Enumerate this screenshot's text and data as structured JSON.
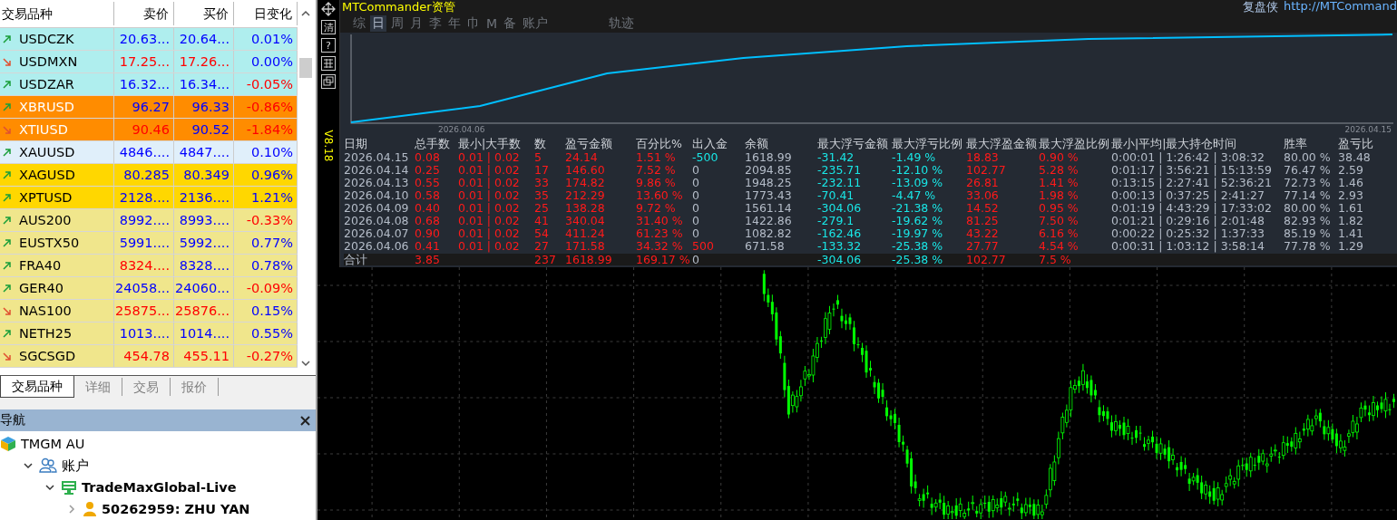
{
  "market_watch": {
    "columns": [
      "交易品种",
      "卖价",
      "买价",
      "日变化"
    ],
    "rows": [
      {
        "symbol": "USDCZK",
        "rising": true,
        "color": "#afeeee",
        "bid": "20.63...",
        "bid_down": false,
        "ask": "20.64...",
        "ask_down": false,
        "change": "0.01%",
        "change_down": false
      },
      {
        "symbol": "USDMXN",
        "rising": false,
        "color": "#afeeee",
        "bid": "17.25...",
        "bid_down": true,
        "ask": "17.26...",
        "ask_down": true,
        "change": "0.00%",
        "change_down": false
      },
      {
        "symbol": "USDZAR",
        "rising": true,
        "color": "#afeeee",
        "bid": "16.32...",
        "bid_down": false,
        "ask": "16.34...",
        "ask_down": false,
        "change": "-0.05%",
        "change_down": true
      },
      {
        "symbol": "XBRUSD",
        "rising": true,
        "color": "#ff8c00",
        "bid": "96.27",
        "bid_down": false,
        "ask": "96.33",
        "ask_down": false,
        "change": "-0.86%",
        "change_down": true
      },
      {
        "symbol": "XTIUSD",
        "rising": false,
        "color": "#ff8c00",
        "bid": "90.46",
        "bid_down": true,
        "ask": "90.52",
        "ask_down": false,
        "change": "-1.84%",
        "change_down": true
      },
      {
        "symbol": "XAUUSD",
        "rising": true,
        "color": "#e0effa",
        "bid": "4846....",
        "bid_down": false,
        "ask": "4847....",
        "ask_down": false,
        "change": "0.10%",
        "change_down": false
      },
      {
        "symbol": "XAGUSD",
        "rising": true,
        "color": "#ffd700",
        "bid": "80.285",
        "bid_down": false,
        "ask": "80.349",
        "ask_down": false,
        "change": "0.96%",
        "change_down": false
      },
      {
        "symbol": "XPTUSD",
        "rising": true,
        "color": "#ffd700",
        "bid": "2128....",
        "bid_down": false,
        "ask": "2136....",
        "ask_down": false,
        "change": "1.21%",
        "change_down": false
      },
      {
        "symbol": "AUS200",
        "rising": true,
        "color": "#f0e68c",
        "bid": "8992....",
        "bid_down": false,
        "ask": "8993....",
        "ask_down": false,
        "change": "-0.33%",
        "change_down": true
      },
      {
        "symbol": "EUSTX50",
        "rising": true,
        "color": "#f0e68c",
        "bid": "5991....",
        "bid_down": false,
        "ask": "5992....",
        "ask_down": false,
        "change": "0.77%",
        "change_down": false
      },
      {
        "symbol": "FRA40",
        "rising": true,
        "color": "#f0e68c",
        "bid": "8324....",
        "bid_down": true,
        "ask": "8328....",
        "ask_down": false,
        "change": "0.78%",
        "change_down": false
      },
      {
        "symbol": "GER40",
        "rising": true,
        "color": "#f0e68c",
        "bid": "24058...",
        "bid_down": false,
        "ask": "24060...",
        "ask_down": false,
        "change": "-0.09%",
        "change_down": true
      },
      {
        "symbol": "NAS100",
        "rising": false,
        "color": "#f0e68c",
        "bid": "25875...",
        "bid_down": true,
        "ask": "25876...",
        "ask_down": true,
        "change": "0.15%",
        "change_down": false
      },
      {
        "symbol": "NETH25",
        "rising": true,
        "color": "#f0e68c",
        "bid": "1013....",
        "bid_down": false,
        "ask": "1014....",
        "ask_down": false,
        "change": "0.55%",
        "change_down": false
      },
      {
        "symbol": "SGCSGD",
        "rising": false,
        "color": "#f0e68c",
        "bid": "454.78",
        "bid_down": true,
        "ask": "455.11",
        "ask_down": true,
        "change": "-0.27%",
        "change_down": true
      }
    ]
  },
  "market_tabs": [
    {
      "label": "交易品种",
      "selected": true
    },
    {
      "label": "详细",
      "selected": false
    },
    {
      "label": "交易",
      "selected": false
    },
    {
      "label": "报价",
      "selected": false
    }
  ],
  "navigator": {
    "title": "导航",
    "tree": [
      {
        "label": "TMGM AU",
        "kind": "broker",
        "children": [
          {
            "label": "账户",
            "kind": "accounts",
            "expanded": true,
            "children": [
              {
                "label": "TradeMaxGlobal-Live",
                "kind": "server",
                "expanded": true,
                "children": [
                  {
                    "label": "50262959: ZHU YAN",
                    "kind": "user",
                    "expanded": false
                  }
                ]
              }
            ]
          }
        ]
      }
    ]
  },
  "chart": {
    "version": "V8.18",
    "tool_buttons": [
      "清",
      "?"
    ]
  },
  "panel": {
    "title": "MTCommander资管",
    "author": "复盘侠",
    "link": "http://MTCommand",
    "tabs": [
      {
        "label": "综",
        "selected": false
      },
      {
        "label": "日",
        "selected": true
      },
      {
        "label": "周",
        "selected": false
      },
      {
        "label": "月",
        "selected": false
      },
      {
        "label": "李",
        "selected": false
      },
      {
        "label": "年",
        "selected": false
      },
      {
        "label": "巾",
        "selected": false
      },
      {
        "label": "M",
        "selected": false
      },
      {
        "label": "备",
        "selected": false
      },
      {
        "label": "账户",
        "selected": false
      }
    ],
    "trail_tab": {
      "label": "轨迹",
      "selected": false
    },
    "equity": {
      "start_label": "2026.04.06",
      "end_label": "2026.04.15"
    },
    "table": {
      "columns": [
        "日期",
        "总手数",
        "最小|大手数",
        "数",
        "盈亏金额",
        "百分比%",
        "出入金",
        "余额",
        "最大浮亏金额",
        "最大浮亏比例",
        "最大浮盈金额",
        "最大浮盈比例",
        "最小|平均|最大持仓时间",
        "胜率",
        "盈亏比"
      ],
      "rows": [
        [
          "2026.04.15",
          "0.08",
          "0.01 | 0.02",
          "5",
          "24.14",
          "1.51 %",
          "-500",
          "1618.99",
          "-31.42",
          "-1.49 %",
          "18.83",
          "0.90 %",
          "0:00:01 | 1:26:42 | 3:08:32",
          "80.00 %",
          "38.48"
        ],
        [
          "2026.04.14",
          "0.25",
          "0.01 | 0.02",
          "17",
          "146.60",
          "7.52 %",
          "0",
          "2094.85",
          "-235.71",
          "-12.10 %",
          "102.77",
          "5.28 %",
          "0:01:17 | 3:56:21 | 15:13:59",
          "76.47 %",
          "2.59"
        ],
        [
          "2026.04.13",
          "0.55",
          "0.01 | 0.02",
          "33",
          "174.82",
          "9.86 %",
          "0",
          "1948.25",
          "-232.11",
          "-13.09 %",
          "26.81",
          "1.41 %",
          "0:13:15 | 2:27:41 | 52:36:21",
          "72.73 %",
          "1.46"
        ],
        [
          "2026.04.10",
          "0.58",
          "0.01 | 0.02",
          "35",
          "212.29",
          "13.60 %",
          "0",
          "1773.43",
          "-70.41",
          "-4.47 %",
          "33.06",
          "1.98 %",
          "0:00:13 | 0:37:25 | 2:41:27",
          "77.14 %",
          "2.93"
        ],
        [
          "2026.04.09",
          "0.40",
          "0.01 | 0.02",
          "25",
          "138.28",
          "9.72 %",
          "0",
          "1561.14",
          "-304.06",
          "-21.38 %",
          "14.52",
          "0.95 %",
          "0:01:19 | 4:43:29 | 17:33:02",
          "80.00 %",
          "1.61"
        ],
        [
          "2026.04.08",
          "0.68",
          "0.01 | 0.02",
          "41",
          "340.04",
          "31.40 %",
          "0",
          "1422.86",
          "-279.1",
          "-19.62 %",
          "81.25",
          "7.50 %",
          "0:01:21 | 0:29:16 | 2:01:48",
          "82.93 %",
          "1.82"
        ],
        [
          "2026.04.07",
          "0.90",
          "0.01 | 0.02",
          "54",
          "411.24",
          "61.23 %",
          "0",
          "1082.82",
          "-162.46",
          "-19.97 %",
          "43.22",
          "6.16 %",
          "0:00:22 | 0:25:32 | 1:37:33",
          "85.19 %",
          "1.41"
        ],
        [
          "2026.04.06",
          "0.41",
          "0.01 | 0.02",
          "27",
          "171.58",
          "34.32 %",
          "500",
          "671.58",
          "-133.32",
          "-25.38 %",
          "27.77",
          "4.54 %",
          "0:00:31 | 1:03:12 | 3:58:14",
          "77.78 %",
          "1.29"
        ]
      ],
      "total": {
        "label": "合计",
        "lots": "3.85",
        "count": "237",
        "pnl": "1618.99",
        "pct": "169.17 %",
        "flow": "0",
        "max_float_loss": "-304.06",
        "max_float_loss_pct": "-25.38 %",
        "max_float_profit": "102.77",
        "max_float_profit_pct": "7.5 %"
      }
    }
  }
}
